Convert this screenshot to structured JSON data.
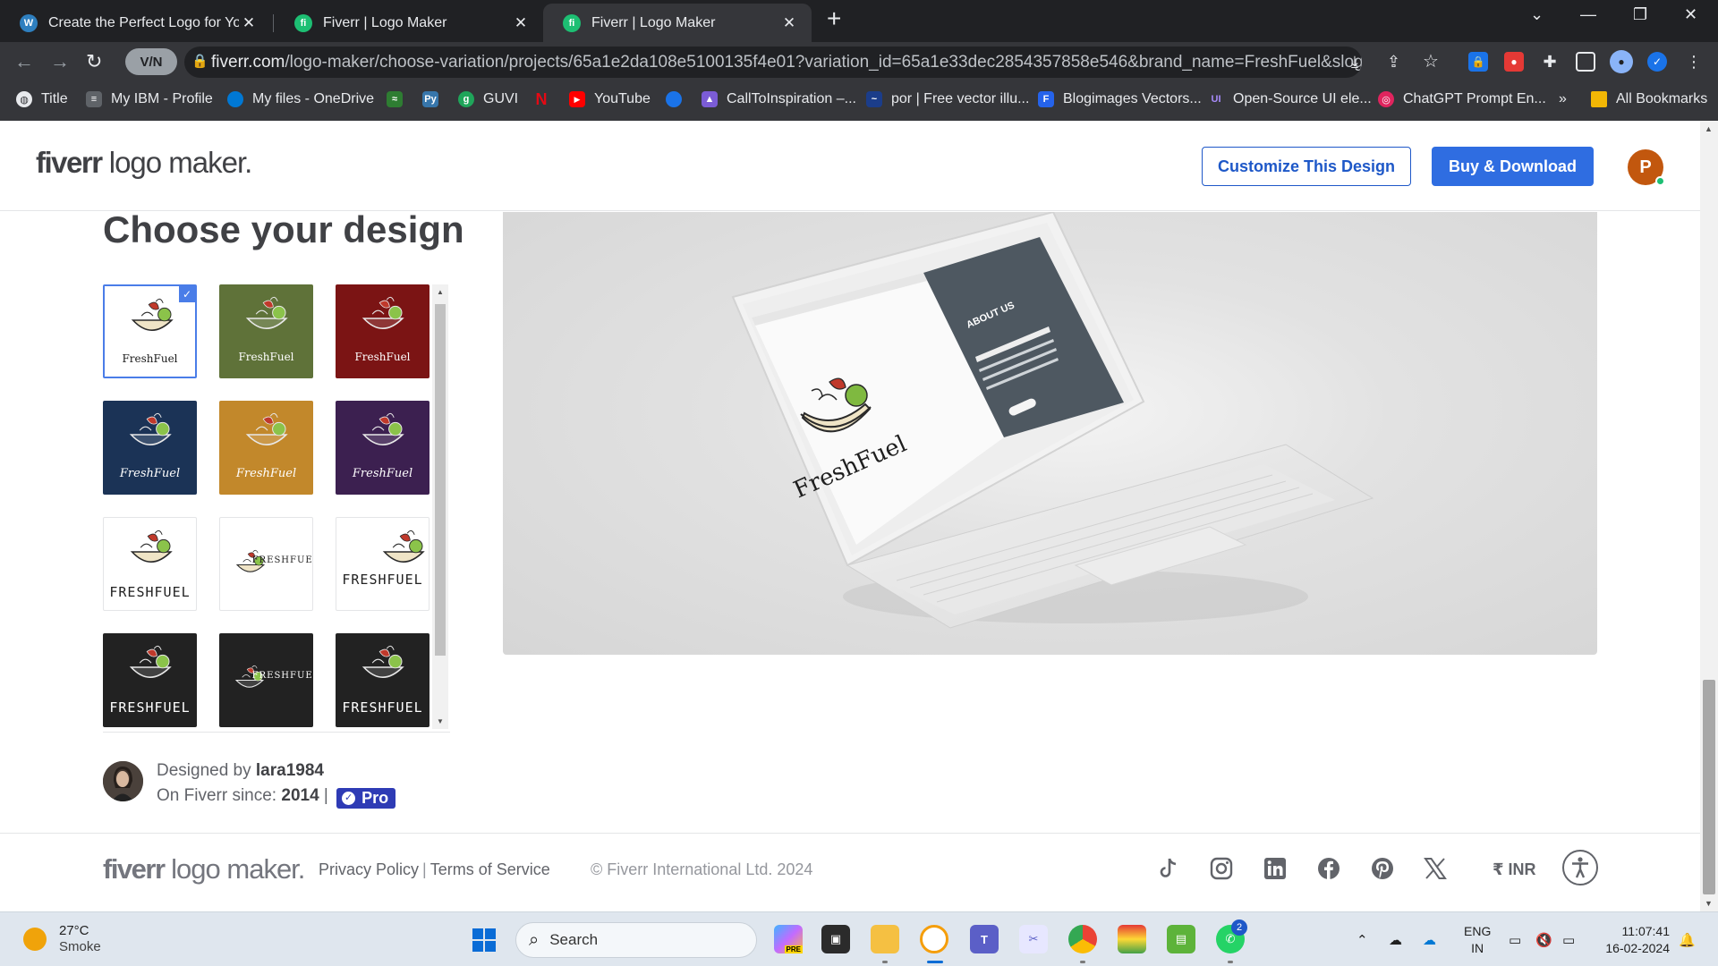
{
  "browser": {
    "tabs": [
      {
        "title": "Create the Perfect Logo for Your",
        "favicon": "wordpress-icon",
        "active": false
      },
      {
        "title": "Fiverr | Logo Maker",
        "favicon": "fiverr-icon",
        "active": false
      },
      {
        "title": "Fiverr | Logo Maker",
        "favicon": "fiverr-icon",
        "active": true
      }
    ],
    "new_tab_symbol": "+",
    "vpn_label": "V/N",
    "url_host": "fiverr.com",
    "url_path": "/logo-maker/choose-variation/projects/65a1e2da108e5100135f4e01?variation_id=65a1e33dec2854357858e546&brand_name=FreshFuel&slogan=&so...",
    "bookmarks": [
      {
        "label": "Title",
        "icon": "globe-icon"
      },
      {
        "label": "My IBM - Profile",
        "icon": "ibm-icon"
      },
      {
        "label": "My files - OneDrive",
        "icon": "onedrive-icon"
      },
      {
        "label": "",
        "icon": "leaf-icon"
      },
      {
        "label": "",
        "icon": "python-icon"
      },
      {
        "label": "GUVI",
        "icon": "guvi-icon"
      },
      {
        "label": "",
        "icon": "netflix-icon"
      },
      {
        "label": "YouTube",
        "icon": "youtube-icon"
      },
      {
        "label": "",
        "icon": "cloud-icon"
      },
      {
        "label": "CallToInspiration –...",
        "icon": "wizard-icon"
      },
      {
        "label": "por | Free vector illu...",
        "icon": "freepik-icon"
      },
      {
        "label": "Blogimages Vectors...",
        "icon": "blogimages-icon"
      },
      {
        "label": "Open-Source UI ele...",
        "icon": "uiverse-icon"
      },
      {
        "label": "ChatGPT Prompt En...",
        "icon": "chatgpt-icon"
      }
    ],
    "bookmarks_overflow": "»",
    "all_bookmarks": "All Bookmarks"
  },
  "header": {
    "brand_bold": "fiverr",
    "brand_rest": " logo maker.",
    "customize_label": "Customize This Design",
    "buy_label": "Buy & Download",
    "avatar_initial": "P"
  },
  "main": {
    "heading": "Choose your design",
    "tiles": [
      {
        "bg": "#ffffff",
        "text": "FreshFuel",
        "text_color": "#1a1a1a",
        "style": "stacked",
        "selected": true
      },
      {
        "bg": "#5f7239",
        "text": "FreshFuel",
        "text_color": "#ffffff",
        "style": "stacked",
        "selected": false
      },
      {
        "bg": "#7b1414",
        "text": "FreshFuel",
        "text_color": "#ffffff",
        "style": "stacked",
        "selected": false
      },
      {
        "bg": "#1b3356",
        "text": "FreshFuel",
        "text_color": "#ffffff",
        "style": "script",
        "selected": false
      },
      {
        "bg": "#c2882b",
        "text": "FreshFuel",
        "text_color": "#ffffff",
        "style": "script",
        "selected": false
      },
      {
        "bg": "#3c2050",
        "text": "FreshFuel",
        "text_color": "#ffffff",
        "style": "script",
        "selected": false
      },
      {
        "bg": "#ffffff",
        "text": "FRESHFUEL",
        "text_color": "#222222",
        "style": "caps",
        "selected": false
      },
      {
        "bg": "#ffffff",
        "text": "FRESHFUEL",
        "text_color": "#222222",
        "style": "inline",
        "selected": false
      },
      {
        "bg": "#ffffff",
        "text": "FRESHFUEL",
        "text_color": "#222222",
        "style": "caps-right",
        "selected": false
      },
      {
        "bg": "#222222",
        "text": "FRESHFUEL",
        "text_color": "#ffffff",
        "style": "caps-dark",
        "selected": false
      },
      {
        "bg": "#222222",
        "text": "FRESHFUEL",
        "text_color": "#ffffff",
        "style": "inline",
        "selected": false
      },
      {
        "bg": "#222222",
        "text": "FRESHFUEL",
        "text_color": "#ffffff",
        "style": "caps",
        "selected": false
      }
    ],
    "designer": {
      "prefix": "Designed by ",
      "name": "lara1984",
      "since_prefix": "On Fiverr since: ",
      "since_year": "2014",
      "divider": " | ",
      "badge": "Pro"
    },
    "preview": {
      "brand_text": "FreshFuel",
      "about_heading": "ABOUT US"
    }
  },
  "footer": {
    "brand_bold": "fiverr",
    "brand_rest": " logo maker.",
    "privacy": "Privacy Policy",
    "separator": "|",
    "terms": "Terms of Service",
    "copyright": "© Fiverr International Ltd. 2024",
    "social": [
      "tiktok-icon",
      "instagram-icon",
      "linkedin-icon",
      "facebook-icon",
      "pinterest-icon",
      "x-icon"
    ],
    "currency": "₹ INR"
  },
  "taskbar": {
    "temp": "27°C",
    "condition": "Smoke",
    "search_placeholder": "Search",
    "lang_top": "ENG",
    "lang_bottom": "IN",
    "time": "11:07:41",
    "date": "16-02-2024",
    "whatsapp_badge": "2",
    "pre_badge": "PRE"
  },
  "colors": {
    "accent": "#2f6de1",
    "outline": "#1e58c8",
    "pro_badge": "#2e3bb5",
    "avatar": "#c2570e"
  }
}
